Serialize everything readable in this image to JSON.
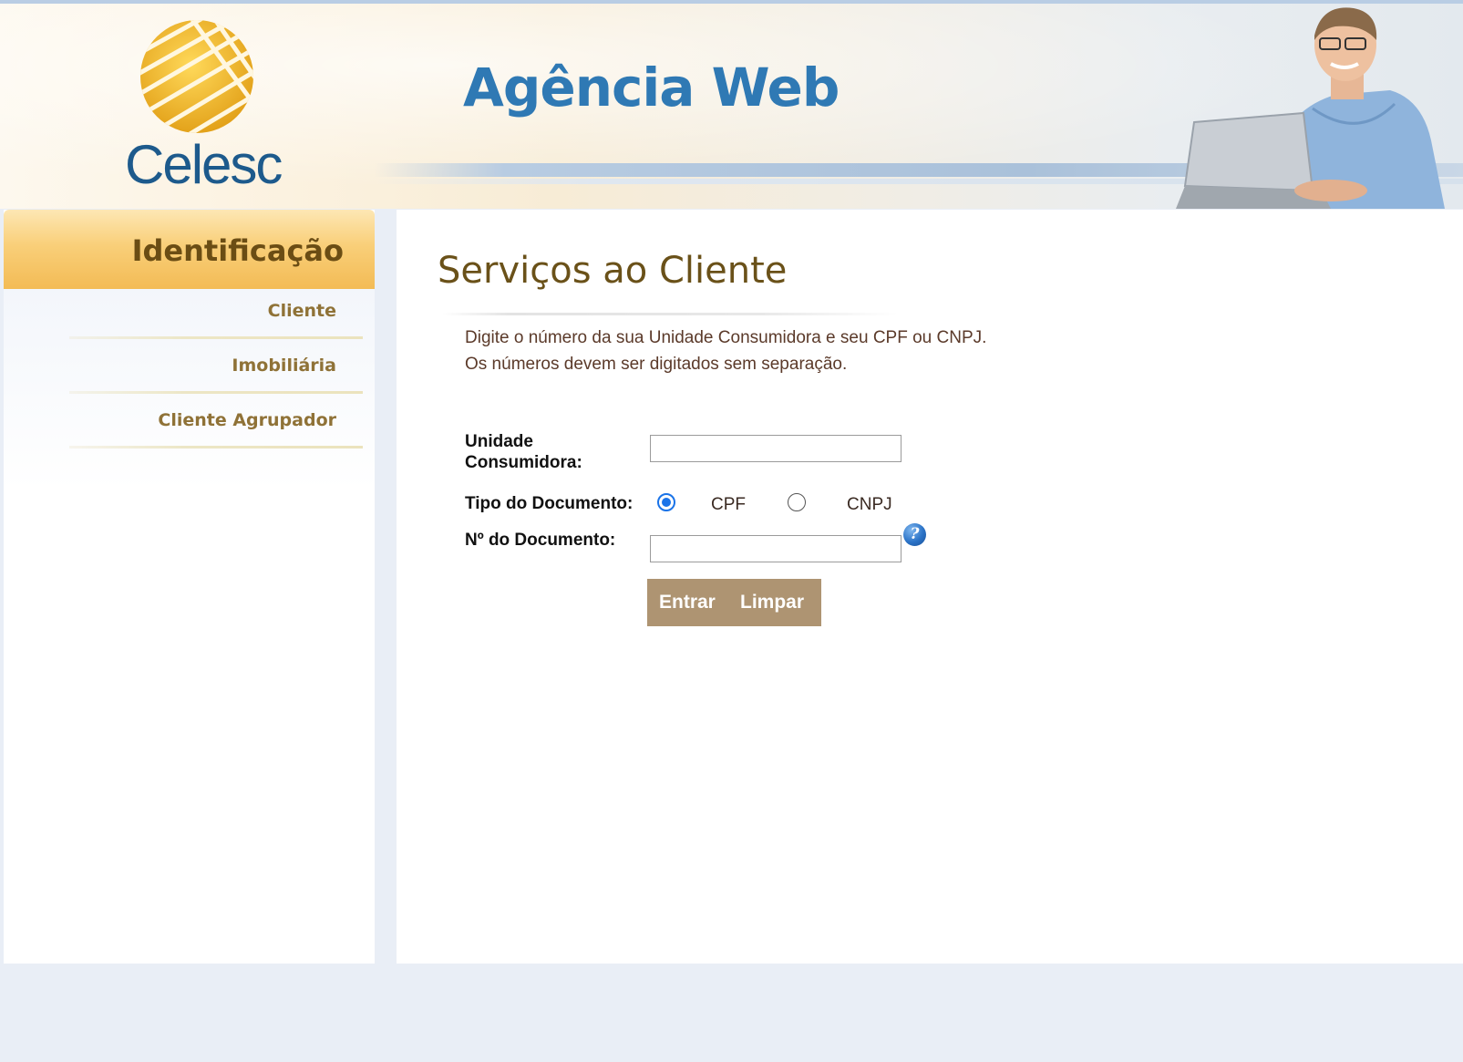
{
  "header": {
    "logo_text": "Celesc",
    "title": "Agência Web"
  },
  "sidebar": {
    "title": "Identificação",
    "items": [
      {
        "label": "Cliente"
      },
      {
        "label": "Imobiliária"
      },
      {
        "label": "Cliente Agrupador"
      }
    ]
  },
  "main": {
    "title": "Serviços ao Cliente",
    "instructions": [
      "Digite o número da sua Unidade Consumidora e seu CPF ou CNPJ.",
      "Os números devem ser digitados sem separação."
    ],
    "form": {
      "uc_label_line1": "Unidade",
      "uc_label_line2": "Consumidora:",
      "uc_value": "",
      "doc_type_label": "Tipo do Documento:",
      "doc_type_options": [
        "CPF",
        "CNPJ"
      ],
      "doc_type_selected": "CPF",
      "doc_number_label": "Nº do Documento:",
      "doc_number_value": "",
      "help_icon": "help-icon"
    },
    "buttons": {
      "enter": "Entrar",
      "clear": "Limpar"
    }
  },
  "colors": {
    "page_bg": "#e9eef6",
    "sidebar_header": "#f3bb55",
    "title_brown": "#6a5119",
    "button_bg": "#ae9472",
    "brand_blue": "#2f79b4"
  }
}
